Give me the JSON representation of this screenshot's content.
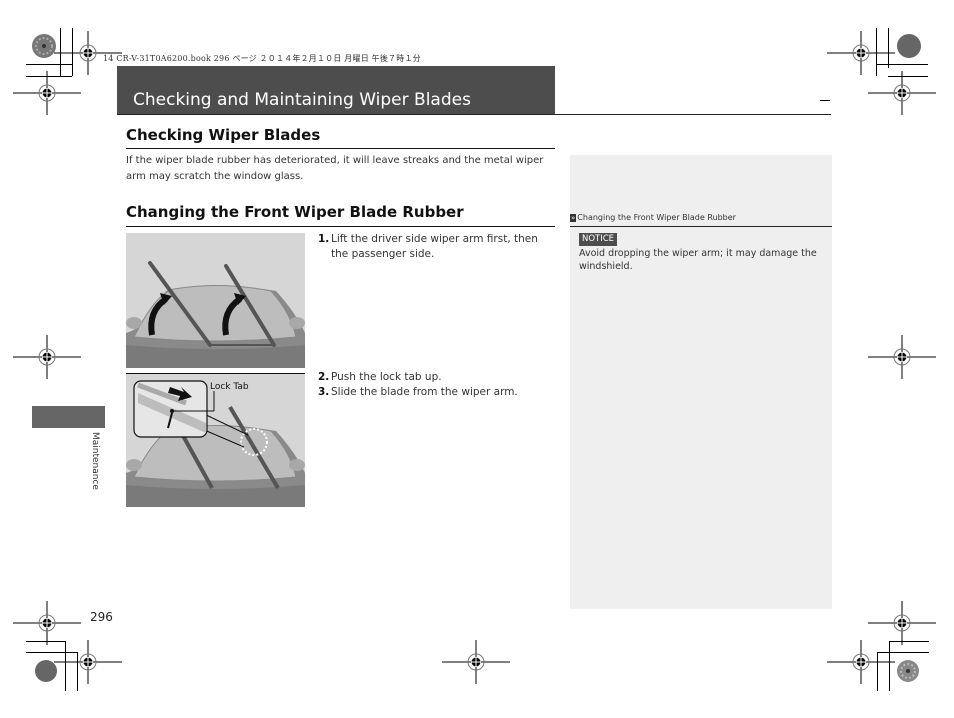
{
  "print_header": "14 CR-V-31T0A6200.book  296 ページ  ２０１４年２月１０日  月曜日  午後７時１分",
  "section_title": "Checking and Maintaining Wiper Blades",
  "checking": {
    "heading": "Checking Wiper Blades",
    "body": "If the wiper blade rubber has deteriorated, it will leave streaks and the metal wiper arm may scratch the window glass."
  },
  "changing": {
    "heading": "Changing the Front Wiper Blade Rubber",
    "steps": [
      {
        "num": "1.",
        "text": "Lift the driver side wiper arm first, then the passenger side."
      },
      {
        "num": "2.",
        "text": "Push the lock tab up."
      },
      {
        "num": "3.",
        "text": "Slide the blade from the wiper arm."
      }
    ],
    "figure2_callout": "Lock Tab"
  },
  "sidebar_note": {
    "link_icon": "double-chevron-right-icon",
    "link_text": "Changing the Front Wiper Blade Rubber",
    "notice_label": "NOTICE",
    "notice_text": "Avoid dropping the wiper arm; it may damage the windshield."
  },
  "chapter_tab": "Maintenance",
  "page_number": "296",
  "colors": {
    "title_bar": "#4d4d4d",
    "side_panel": "#efefef",
    "figure_bg": "#d6d6d6",
    "chapter_tab": "#666666"
  }
}
